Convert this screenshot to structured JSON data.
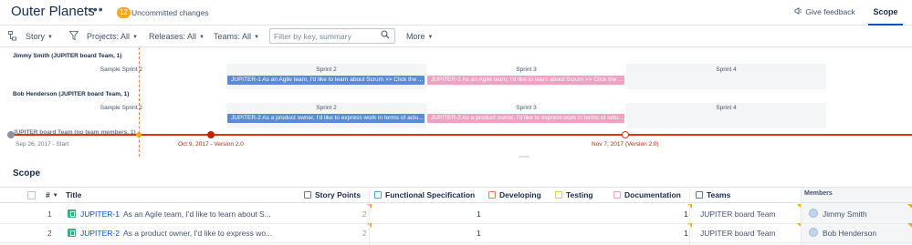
{
  "header": {
    "title": "Outer Planets",
    "more_label": "•••",
    "uncommitted_count": "12",
    "uncommitted_label": "Uncommitted changes",
    "feedback_label": "Give feedback",
    "tab_scope": "Scope"
  },
  "toolbar": {
    "story_label": "Story",
    "projects_label": "Projects: All",
    "releases_label": "Releases: All",
    "teams_label": "Teams: All",
    "filter_placeholder": "Filter by key, summary",
    "more_label": "More"
  },
  "timeline": {
    "rows": [
      {
        "person": "Jimmy Smith (JUPITER board Team, 1)",
        "sprints": [
          "Sample Sprint 2",
          "Sprint 2",
          "Sprint 3",
          "Sprint 4"
        ],
        "bars": [
          "JUPITER-1 As an Agile team, I'd like to learn about Scrum >> Click the ...",
          "JUPITER-1 As an Agile team, I'd like to learn about Scrum >> Click the ..."
        ]
      },
      {
        "person": "Bob Henderson (JUPITER board Team, 1)",
        "sprints": [
          "Sample Sprint 2",
          "Sprint 2",
          "Sprint 3",
          "Sprint 4"
        ],
        "bars": [
          "JUPITER-2 As a product owner, I'd like to express work in terms of actu...",
          "JUPITER-2 As a product owner, I'd like to express work in terms of actu..."
        ]
      }
    ],
    "overlap_label": "JUPITER board Team (no team members, 1)",
    "release_labels": {
      "start": "Sep 26, 2017 - Start",
      "v1": "Oct 9, 2017 - Version 2.0",
      "v2": "Nov 7, 2017 (Version 2.0)"
    },
    "colors": {
      "release_line": "#de350b",
      "bar_blue": "#5b8bd6",
      "bar_pink": "#f3a1c2"
    }
  },
  "scope": {
    "title": "Scope",
    "columns": {
      "num": "#",
      "title": "Title",
      "story_points": "Story Points",
      "functional_spec": "Functional Specification",
      "developing": "Developing",
      "testing": "Testing",
      "documentation": "Documentation",
      "teams": "Teams",
      "members": "Members"
    },
    "rows": [
      {
        "num": "1",
        "key": "JUPITER-1",
        "summary": "As an Agile team, I'd like to learn about S...",
        "story_points": "2",
        "functional_spec": "1",
        "documentation": "1",
        "team": "JUPITER board Team",
        "member": "Jimmy Smith"
      },
      {
        "num": "2",
        "key": "JUPITER-2",
        "summary": "As a product owner, I'd like to express wo...",
        "story_points": "2",
        "functional_spec": "1",
        "documentation": "1",
        "team": "JUPITER board Team",
        "member": "Bob Henderson"
      }
    ]
  }
}
